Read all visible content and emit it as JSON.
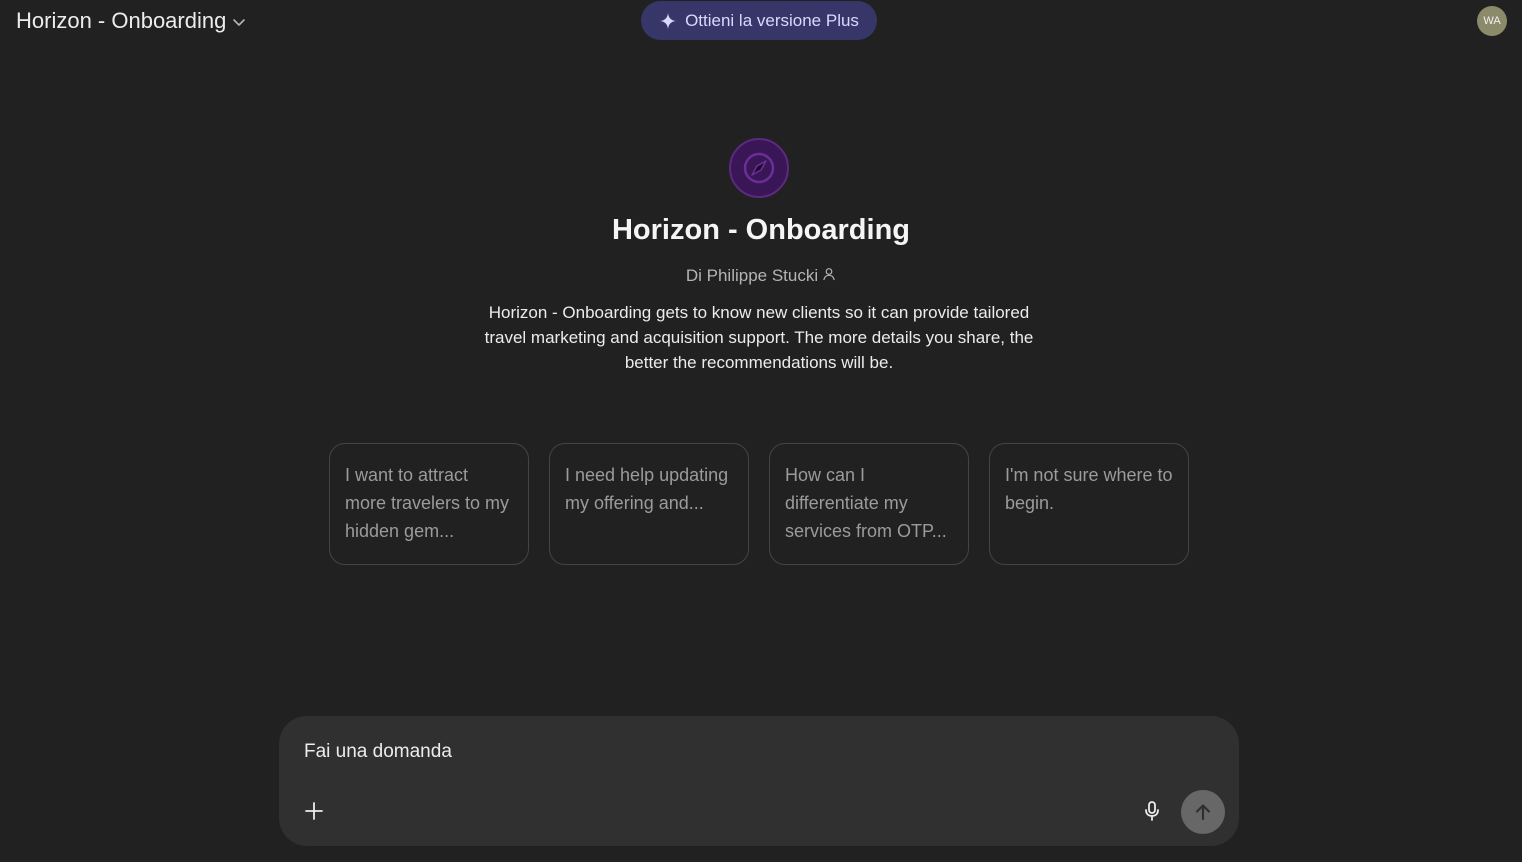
{
  "header": {
    "model_title": "Horizon - Onboarding",
    "upgrade_label": "Ottieni la versione Plus",
    "avatar_initials": "WA"
  },
  "gpt": {
    "name": "Horizon - Onboarding",
    "author": "Di Philippe Stucki",
    "description": "Horizon - Onboarding gets to know new clients so it can provide tailored travel marketing and acquisition support. The more details you share, the better the recommendations will be.",
    "logo_icon": "compass-icon"
  },
  "suggestions": [
    {
      "label": "I want to attract more travelers to my hidden gem..."
    },
    {
      "label": "I need help updating my offering and..."
    },
    {
      "label": "How can I differentiate my services from OTP..."
    },
    {
      "label": "I'm not sure where to begin."
    }
  ],
  "composer": {
    "placeholder": "Fai una domanda"
  },
  "colors": {
    "background": "#212121",
    "composer": "#303030",
    "upgrade_button": "#373669",
    "logo": "#3a1656"
  }
}
